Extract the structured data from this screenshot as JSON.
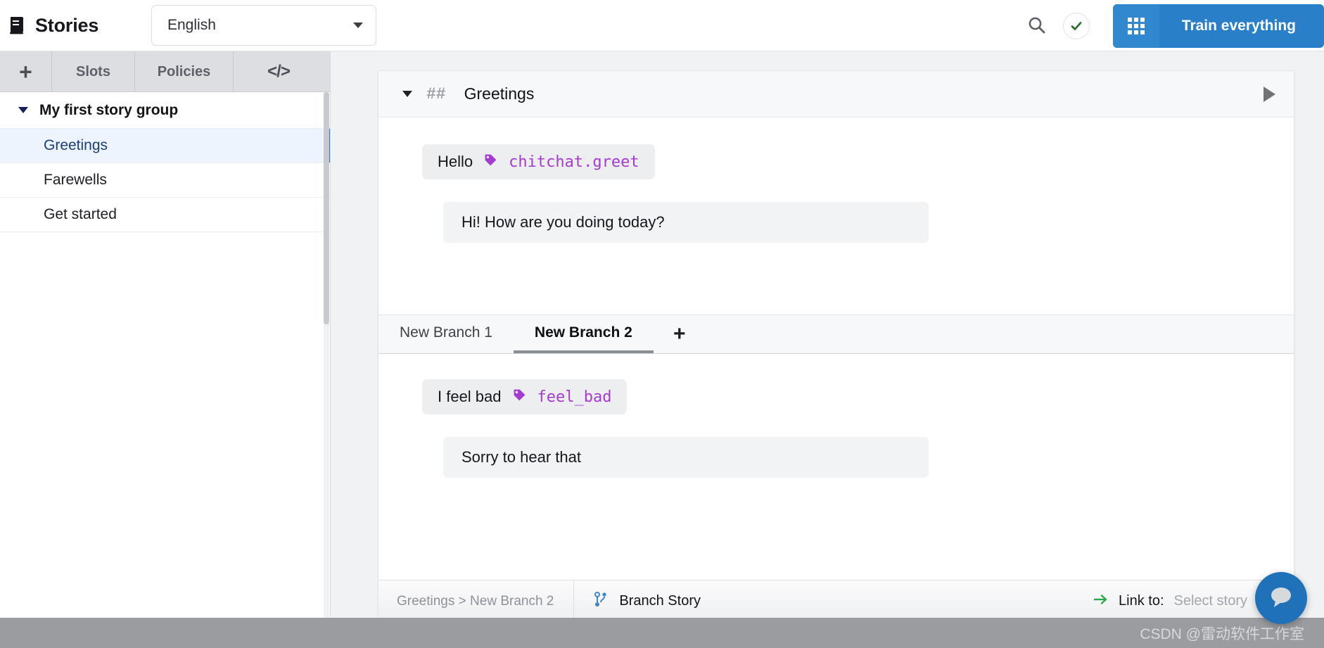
{
  "topbar": {
    "brand_icon": "book-icon",
    "brand_title": "Stories",
    "language_value": "English",
    "search_icon": "search-icon",
    "status_icon": "check-circle-icon",
    "train_button_label": "Train everything",
    "train_button_icon": "grid-icon",
    "accent_blue": "#2a7fc9"
  },
  "sidebar": {
    "tabs": [
      {
        "label": "+",
        "name": "add"
      },
      {
        "label": "Slots",
        "name": "slots"
      },
      {
        "label": "Policies",
        "name": "policies"
      },
      {
        "label": "</>",
        "name": "code"
      }
    ],
    "group": {
      "name": "My first story group",
      "expanded": true
    },
    "stories": [
      {
        "label": "Greetings",
        "active": true
      },
      {
        "label": "Farewells",
        "active": false
      },
      {
        "label": "Get started",
        "active": false
      }
    ],
    "selected_accent": "#2a7fc9"
  },
  "story": {
    "hash_marker": "##",
    "title": "Greetings",
    "play_icon": "play-icon",
    "user_message": {
      "text": "Hello",
      "intent": "chitchat.greet",
      "intent_color": "#a63bd1"
    },
    "bot_message": "Hi! How are you doing today?"
  },
  "branches": {
    "tabs": [
      {
        "label": "New Branch 1",
        "active": false
      },
      {
        "label": "New Branch 2",
        "active": true
      }
    ],
    "add_label": "+",
    "user_message": {
      "text": "I feel bad",
      "intent": "feel_bad",
      "intent_color": "#a63bd1"
    },
    "bot_message": "Sorry to hear that"
  },
  "status_bar": {
    "breadcrumb": "Greetings > New Branch 2",
    "branch_story_label": "Branch Story",
    "branch_icon": "git-branch-icon",
    "link_arrow_icon": "arrow-right-icon",
    "link_label": "Link to:",
    "link_placeholder": "Select story"
  },
  "chat_widget": {
    "icon": "chat-bubble-icon",
    "color": "#1f72b8"
  },
  "watermark": {
    "text": "CSDN @雷动软件工作室"
  }
}
